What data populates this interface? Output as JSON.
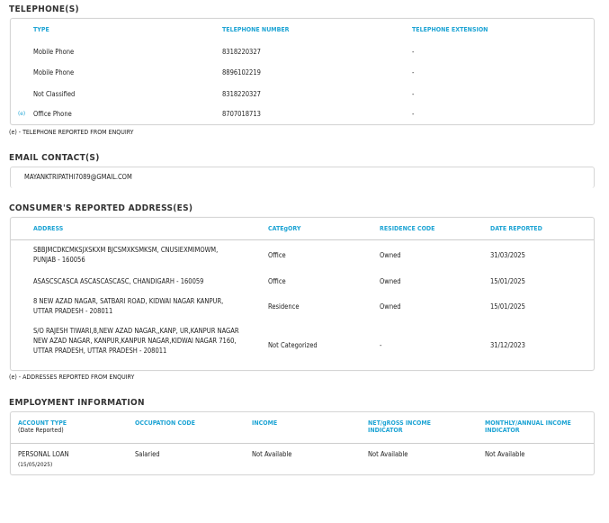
{
  "telephones": {
    "title": "TELEPHONE(S)",
    "headers": [
      "TYPE",
      "TELEPHONE NUMBER",
      "TELEPHONE EXTENSION"
    ],
    "rows": [
      {
        "flag": "",
        "type": "Mobile Phone",
        "number": "8318220327",
        "ext": "-"
      },
      {
        "flag": "",
        "type": "Mobile Phone",
        "number": "8896102219",
        "ext": "-"
      },
      {
        "flag": "",
        "type": "Not Classified",
        "number": "8318220327",
        "ext": "-"
      },
      {
        "flag": "(e)",
        "type": "Office Phone",
        "number": "8707018713",
        "ext": "-"
      }
    ],
    "footnote": "(e) - TELEPHONE REPORTED FROM ENQUIRY"
  },
  "email": {
    "title": "EMAIL CONTACT(S)",
    "value": "MAYANKTRIPATHI7089@GMAIL.COM"
  },
  "addresses": {
    "title": "CONSUMER'S REPORTED ADDRESS(ES)",
    "headers": [
      "ADDRESS",
      "CATEgORY",
      "RESIDENCE CODE",
      "DATE REPORTED"
    ],
    "rows": [
      {
        "address": "SBBJMCDKCMKSJXSKXM BJCSMXKSMKSM, CNUSIEXMIMOWM, PUNJAB - 160056",
        "category": "Office",
        "residence": "Owned",
        "date": "31/03/2025"
      },
      {
        "address": "ASASCSCASCA ASCASCASCASC, CHANDIGARH - 160059",
        "category": "Office",
        "residence": "Owned",
        "date": "15/01/2025"
      },
      {
        "address": "8 NEW AZAD NAGAR, SATBARI ROAD, KIDWAI NAGAR KANPUR, UTTAR PRADESH - 208011",
        "category": "Residence",
        "residence": "Owned",
        "date": "15/01/2025"
      },
      {
        "address": "S/O RAJESH TIWARI,8,NEW AZAD NAGAR,,KANP, UR,KANPUR NAGAR NEW AZAD NAGAR, KANPUR,KANPUR NAGAR,KIDWAI NAGAR 7160, UTTAR PRADESH, UTTAR PRADESH - 208011",
        "category": "Not Categorized",
        "residence": "-",
        "date": "31/12/2023"
      }
    ],
    "footnote": "(e) - ADDRESSES REPORTED FROM ENQUIRY"
  },
  "employment": {
    "title": "EMPLOYMENT INFORMATION",
    "headers": [
      "ACCOUNT TYPE",
      "OCCUPATION CODE",
      "INCOME",
      "NET/gROSS INCOME INDICATOR",
      "MONTHLY/ANNUAL INCOME INDICATOR"
    ],
    "header_sub": "(Date Reported)",
    "row": {
      "account_type": "PERSONAL LOAN",
      "date": "(15/05/2025)",
      "occupation": "Salaried",
      "income": "Not Available",
      "net_gross": "Not Available",
      "monthly_annual": "Not Available"
    }
  }
}
